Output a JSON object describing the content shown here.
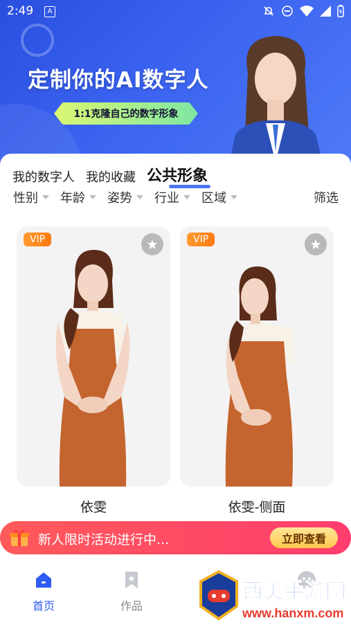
{
  "status_bar": {
    "time": "2:49",
    "a_label": "A"
  },
  "banner": {
    "headline": "定制你的AI数字人",
    "subline": "1:1克隆自己的数字形象"
  },
  "tabs": [
    {
      "label": "我的数字人"
    },
    {
      "label": "我的收藏"
    },
    {
      "label": "公共形象"
    }
  ],
  "filters": [
    {
      "label": "性别"
    },
    {
      "label": "年龄"
    },
    {
      "label": "姿势"
    },
    {
      "label": "行业"
    },
    {
      "label": "区域"
    }
  ],
  "screen_label": "筛选",
  "cards": [
    {
      "badge": "VIP",
      "name": "依雯"
    },
    {
      "badge": "VIP",
      "name": "依雯-侧面"
    }
  ],
  "promo": {
    "text": "新人限时活动进行中...",
    "button": "立即查看"
  },
  "nav": [
    {
      "label": "首页"
    },
    {
      "label": "作品"
    }
  ],
  "watermark": {
    "title": "西美手游网",
    "url": "www.hanxm.com"
  },
  "colors": {
    "accent": "#2e5cf2",
    "vip": "#ff8a20",
    "promo": "#ff4d63"
  }
}
